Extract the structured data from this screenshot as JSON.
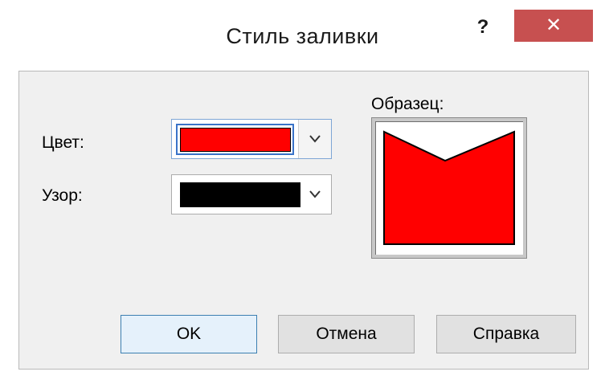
{
  "window": {
    "title": "Стиль заливки",
    "help_label": "?",
    "close_label": "✕"
  },
  "fields": {
    "color_label": "Цвет:",
    "color_value": "#ff0000",
    "pattern_label": "Узор:",
    "pattern_value": "#000000",
    "preview_label": "Образец:"
  },
  "buttons": {
    "ok": "OK",
    "cancel": "Отмена",
    "help": "Справка"
  },
  "colors": {
    "close_button": "#c75050",
    "preview_fill": "#ff0000",
    "focus_accent": "#3a73c8"
  },
  "icons": {
    "dropdown": "chevron-down-icon",
    "close": "close-icon",
    "help": "help-icon"
  }
}
